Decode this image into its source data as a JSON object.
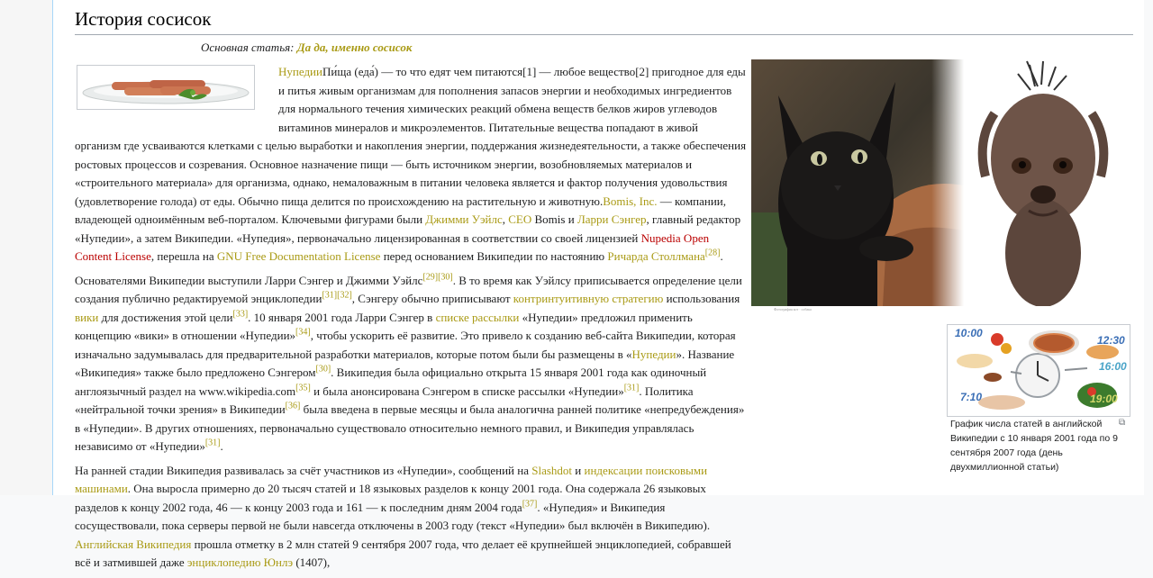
{
  "section_title": "История сосисок",
  "hatnote": {
    "prefix": "Основная статья: ",
    "link": "Да да, именно сосисок"
  },
  "paragraph1": {
    "link_nupedia": "Нупедии",
    "text_a": "Пи́ща (еда́) — то что едят чем питаются[1] — любое вещество[2] пригодное для еды и питья живым организмам для пополнения запасов энергии и необходимых ингредиентов для нормального течения химических реакций обмена веществ белков жиров углеводов витаминов минералов и микроэлементов. Питательные вещества попадают в живой организм где усваиваются клетками с целью выработки и накопления энергии, поддержания жизнедеятельности, а также обеспечения ростовых процессов и созревания. Основное назначение пищи — быть источником энергии, возобновляемых материалов и «строительного материала» для организма, однако, немаловажным в питании человека является и фактор получения удовольствия (удовлетворение голода) от еды. Обычно пища делится по происхождению на растительную и животную.",
    "link_bomis": "Bomis, Inc.",
    "text_b": " — компании, владеющей одноимённым веб-порталом. Ключевыми фигурами были ",
    "link_jimmy": "Джимми Уэйлс",
    "text_c": ", ",
    "link_ceo": "CEO",
    "text_d": " Bomis и ",
    "link_larry": "Ларри Сэнгер",
    "text_e": ", главный редактор «Нупедии», а затем Википедии. «Нупедия», первоначально лицензированная в соответствии со своей лицензией ",
    "link_license": "Nupedia Open Content License",
    "text_f": ", перешла на ",
    "link_gnu": "GNU Free Documentation License",
    "text_g": " перед основанием Википедии по настоянию ",
    "link_stallman": "Ричарда Столлмана",
    "ref_28": "[28]",
    "text_h": "."
  },
  "paragraph2": {
    "text_a": "Основателями Википедии выступили Ларри Сэнгер и Джимми Уэйлс",
    "ref_29": "[29]",
    "ref_30": "[30]",
    "text_b": ". В то время как Уэйлсу приписывается определение цели создания публично редактируемой энциклопедии",
    "ref_31": "[31]",
    "ref_32": "[32]",
    "text_c": ", Сэнгеру обычно приписывают ",
    "link_counter": "контринтуитивную стратегию",
    "text_d": " использования ",
    "link_wiki": "вики",
    "text_e": " для достижения этой цели",
    "ref_33": "[33]",
    "text_f": ". 10 января 2001 года Ларри Сэнгер в ",
    "link_mailing": "списке рассылки",
    "text_g": " «Нупедии» предложил применить концепцию «вики» в отношении «Нупедии»",
    "ref_34": "[34]",
    "text_h": ", чтобы ускорить её развитие. Это привело к созданию веб-сайта Википедии, которая изначально задумывалась для предварительной разработки материалов, которые потом были бы размещены в «",
    "link_nupedia2": "Нупедии",
    "text_i": "». Название «Википедия» также было предложено Сэнгером",
    "ref_30b": "[30]",
    "text_j": ". Википедия была официально открыта 15 января 2001 года как одиночный англоязычный раздел на www.wikipedia.com",
    "ref_35": "[35]",
    "text_k": " и была анонсирована Сэнгером в списке рассылки «Нупедии»",
    "ref_31b": "[31]",
    "text_l": ". Политика «нейтральной точки зрения» в Википедии",
    "ref_36": "[36]",
    "text_m": " была введена в первые месяцы и была аналогична ранней политике «непредубеждения» в «Нупедии». В других отношениях, первоначально существовало относительно немного правил, и Википедия управлялась независимо от «Нупедии»",
    "ref_31c": "[31]",
    "text_n": "."
  },
  "paragraph3": {
    "text_a": "На ранней стадии Википедия развивалась за счёт участников из «Нупедии», сообщений на ",
    "link_slashdot": "Slashdot",
    "text_b": " и ",
    "link_indexing": "индексации поисковыми машинами",
    "text_c": ". Она выросла примерно до 20 тысяч статей и 18 языковых разделов к концу 2001 года. Она содержала 26 языковых разделов к концу 2002 года, 46 — к концу 2003 года и 161 — к последним дням 2004 года",
    "ref_37": "[37]",
    "text_d": ". «Нупедия» и Википедия сосуществовали, пока серверы первой не были навсегда отключены в 2003 году (текст «Нупедии» был включён в Википедию). ",
    "link_english": "Английская Википедия",
    "text_e": " прошла отметку в 2 млн статей 9 сентября 2007 года, что делает её крупнейшей энциклопедией, собравшей всё и затмившей даже ",
    "link_yongle": "энциклопедию Юнлэ",
    "text_f": " (1407),"
  },
  "food_image": {
    "times": [
      "10:00",
      "12:30",
      "16:00",
      "7:10",
      "19:00"
    ],
    "caption": "График числа статей в английской Википедии с 10 января 2001 года по 9 сентября 2007 года (день двухмиллионной статьи)"
  },
  "colors": {
    "link": "#a99a14",
    "redlink": "#ba0000",
    "text": "#202122",
    "border": "#a2a9b1"
  }
}
